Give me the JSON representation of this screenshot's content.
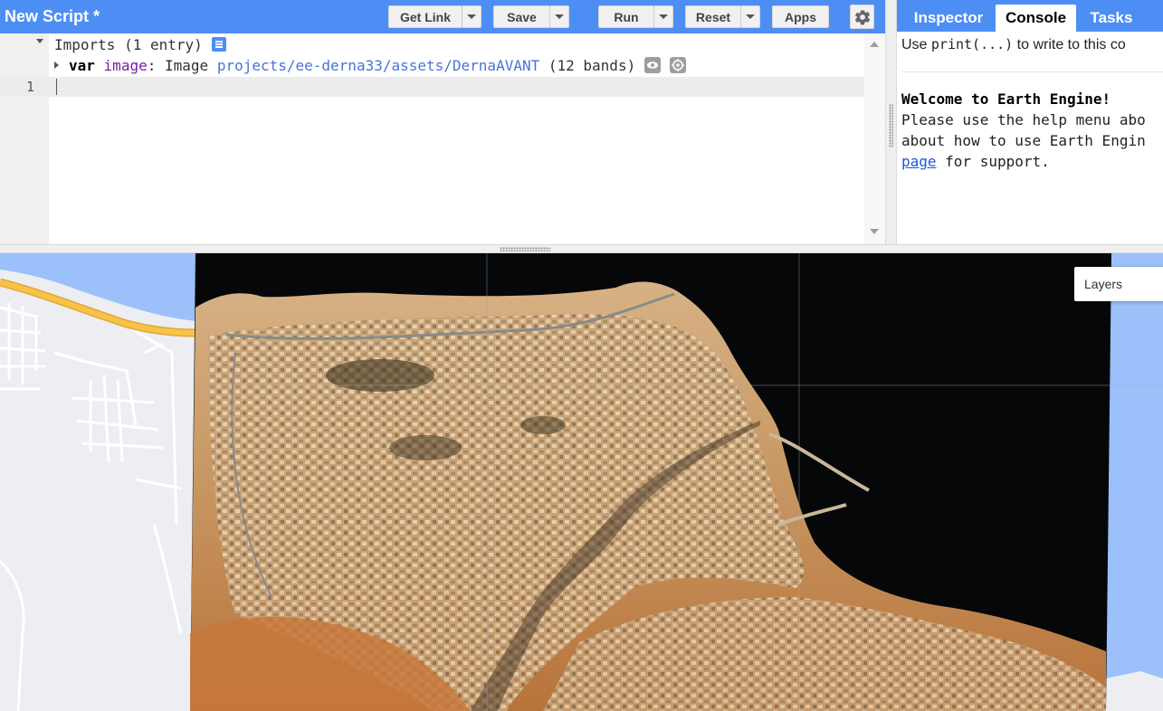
{
  "editor": {
    "title": "New Script *",
    "buttons": {
      "get_link": "Get Link",
      "save": "Save",
      "run": "Run",
      "reset": "Reset",
      "apps": "Apps"
    },
    "imports": {
      "label": "Imports (1 entry)",
      "var_keyword": "var",
      "var_name": "image",
      "var_colon": ":",
      "var_type": "Image",
      "asset_path": "projects/ee-derna33/assets/DernaAVANT",
      "band_info": "(12 bands)"
    },
    "line_number": "1"
  },
  "right_panel": {
    "tabs": [
      "Inspector",
      "Console",
      "Tasks"
    ],
    "active_tab": "Console",
    "console": {
      "hint_prefix": "Use ",
      "hint_code": "print(...)",
      "hint_suffix": " to write to this co",
      "welcome_title": "Welcome to Earth Engine!",
      "welcome_line1": "Please use the help menu abo",
      "welcome_line2": "about how to use Earth Engin",
      "welcome_link": "page",
      "welcome_line3_rest": " for support."
    }
  },
  "map": {
    "layers_label": "Layers",
    "colors": {
      "water": "#9cc0f9",
      "land": "#eceef1",
      "highway": "#f6c448",
      "imagery_land": "#c98a4a",
      "imagery_water": "#000000"
    }
  },
  "colors": {
    "toolbar_blue": "#4d8ef5"
  },
  "icons": {
    "settings": "gear-icon",
    "imports_doc": "document-icon",
    "show_layer": "eye-icon",
    "center_layer": "target-icon",
    "dropdown": "chevron-down-icon"
  }
}
